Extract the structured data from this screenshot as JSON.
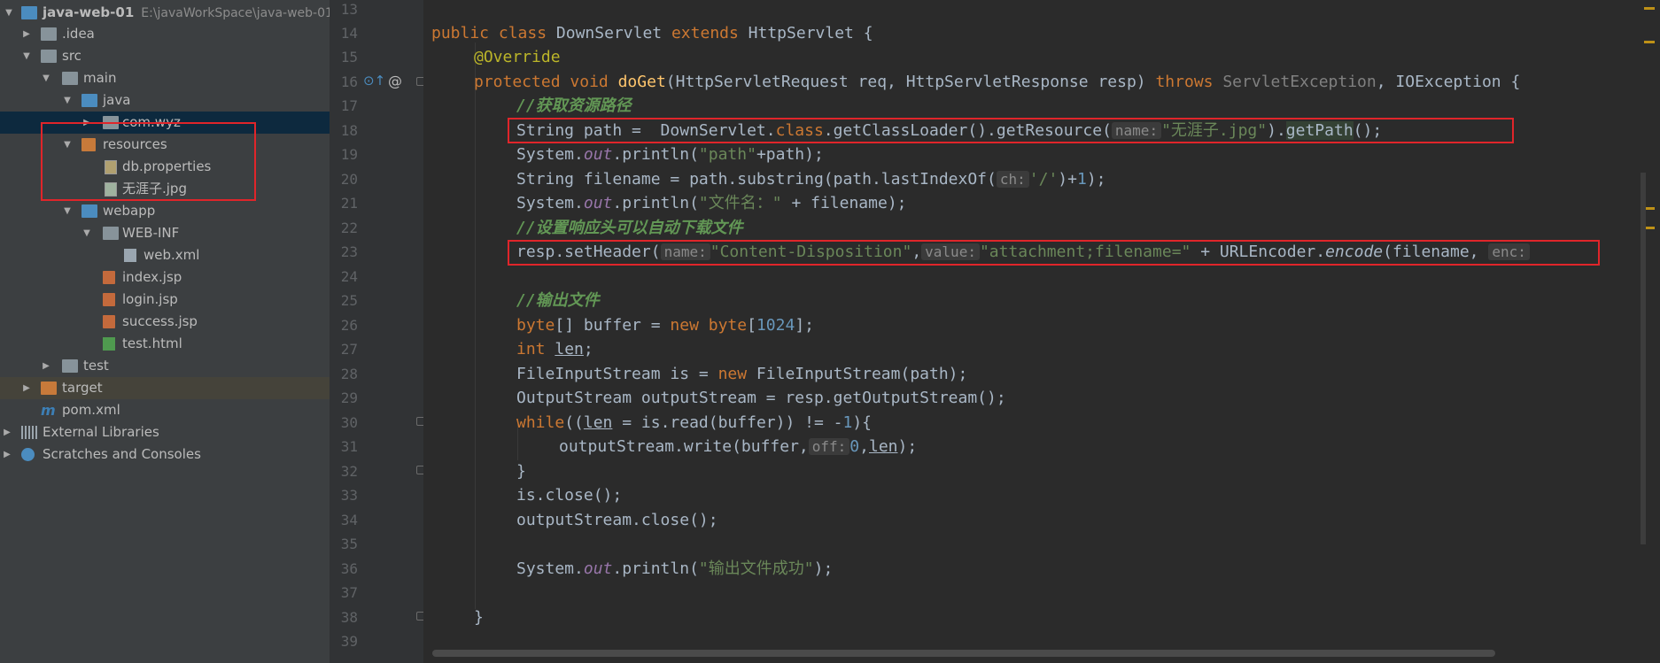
{
  "project_tree": {
    "root_name": "java-web-01",
    "root_path": "E:\\javaWorkSpace\\java-web-01",
    "items": [
      {
        "label": ".idea"
      },
      {
        "label": "src"
      },
      {
        "label": "main"
      },
      {
        "label": "java"
      },
      {
        "label": "com.wyz"
      },
      {
        "label": "resources"
      },
      {
        "label": "db.properties"
      },
      {
        "label": "无涯子.jpg"
      },
      {
        "label": "webapp"
      },
      {
        "label": "WEB-INF"
      },
      {
        "label": "web.xml"
      },
      {
        "label": "index.jsp"
      },
      {
        "label": "login.jsp"
      },
      {
        "label": "success.jsp"
      },
      {
        "label": "test.html"
      },
      {
        "label": "test"
      },
      {
        "label": "target"
      },
      {
        "label": "pom.xml"
      },
      {
        "label": "External Libraries"
      },
      {
        "label": "Scratches and Consoles"
      }
    ]
  },
  "editor": {
    "line_numbers": [
      "13",
      "14",
      "15",
      "16",
      "17",
      "18",
      "19",
      "20",
      "21",
      "22",
      "23",
      "24",
      "25",
      "26",
      "27",
      "28",
      "29",
      "30",
      "31",
      "32",
      "33",
      "34",
      "35",
      "36",
      "37",
      "38",
      "39"
    ],
    "gutter_icons": {
      "override": "⊙↑",
      "at": "@"
    },
    "code": {
      "l14": {
        "kw1": "public",
        "kw2": "class",
        "name": "DownServlet",
        "kw3": "extends",
        "sup": "HttpServlet {"
      },
      "l15": {
        "ann": "@Override"
      },
      "l16": {
        "kw1": "protected",
        "kw2": "void",
        "fn": "doGet",
        "params": "(HttpServletRequest req, HttpServletResponse resp) ",
        "kw3": "throws",
        "ex1": "ServletException",
        "rest": ", IOException {"
      },
      "l17": {
        "cmt": "//获取资源路径"
      },
      "l18": {
        "a": "String path =  DownServlet.",
        "kw": "class",
        ".b": ".getClassLoader().getResource(",
        "hint": "name:",
        "str": "\"无涯子.jpg\"",
        "c": ").",
        "hl": "getPath",
        "d": "();"
      },
      "l19": {
        "a": "System.",
        "out": "out",
        ".b": ".println(",
        "str": "\"path\"",
        "c": "+path);"
      },
      "l20": {
        "a": "String filename = path.substring(path.lastIndexOf(",
        "hint": "ch:",
        "str": "'/'",
        "c": ")+",
        "num": "1",
        "d": ");"
      },
      "l21": {
        "a": "System.",
        "out": "out",
        ".b": ".println(",
        "str": "\"文件名：\"",
        "c": " + filename);"
      },
      "l22": {
        "cmt": "//设置响应头可以自动下载文件"
      },
      "l23": {
        "a": "resp.setHeader(",
        "hint1": "name:",
        "str1": "\"Content-Disposition\"",
        "sep": ",",
        "hint2": "value:",
        "str2": "\"attachment;filename=\"",
        "b": " + URLEncoder.",
        "it": "encode",
        "c": "(filename,",
        "hint3": "enc:"
      },
      "l25": {
        "cmt": "//输出文件"
      },
      "l26": {
        "kw1": "byte",
        "a": "[] buffer = ",
        "kw2": "new",
        "kw3": " byte",
        "b": "[",
        "num": "1024",
        "c": "];"
      },
      "l27": {
        "kw": "int",
        "a": " ",
        "len": "len",
        ";": ";"
      },
      "l28": {
        "a": "FileInputStream is = ",
        "kw": "new",
        "b": " FileInputStream(path);"
      },
      "l29": {
        "a": "OutputStream outputStream = resp.getOutputStream();"
      },
      "l30": {
        "kw": "while",
        "a": "((",
        "len": "len",
        "b": " = is.read(buffer)) != -",
        "num": "1",
        "c": "){"
      },
      "l31": {
        "a": "outputStream.write(buffer,",
        "hint": "off:",
        "num": "0",
        ",": ",",
        "len": "len",
        "c": ");"
      },
      "l32": {
        "a": "}"
      },
      "l33": {
        "a": "is.close();"
      },
      "l34": {
        "a": "outputStream.close();"
      },
      "l36": {
        "a": "System.",
        "out": "out",
        "b": ".println(",
        "str": "\"输出文件成功\"",
        "c": ");"
      },
      "l38": {
        "a": "}"
      }
    }
  },
  "colors": {
    "keyword": "#cc7832",
    "string": "#6a8759",
    "comment": "#629755",
    "number": "#6897bb",
    "annotation": "#bbb529",
    "highlight_box": "#e0252a"
  }
}
